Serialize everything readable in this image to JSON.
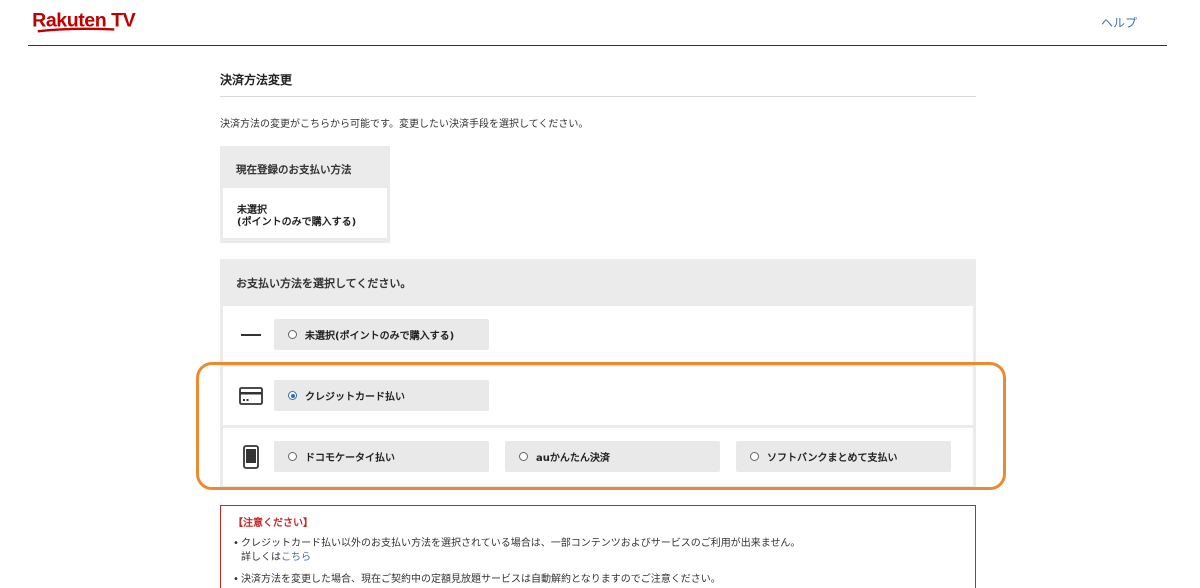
{
  "header": {
    "logo_text": "Rakuten TV",
    "help_label": "ヘルプ",
    "brand_color": "#bf0000"
  },
  "page": {
    "title": "決済方法変更",
    "intro": "決済方法の変更がこちらから可能です。変更したい決済手段を選択してください。"
  },
  "current": {
    "heading": "現在登録のお支払い方法",
    "line1": "未選択",
    "line2": "(ポイントのみで購入する)"
  },
  "select": {
    "heading": "お支払い方法を選択してください。",
    "rows": [
      {
        "icon": "dash-icon",
        "options": [
          {
            "label": "未選択(ポイントのみで購入する)",
            "checked": false
          }
        ]
      },
      {
        "icon": "credit-card-icon",
        "options": [
          {
            "label": "クレジットカード払い",
            "checked": true
          }
        ]
      },
      {
        "icon": "mobile-phone-icon",
        "options": [
          {
            "label": "ドコモケータイ払い",
            "checked": false
          },
          {
            "label": "auかんたん決済",
            "checked": false
          },
          {
            "label": "ソフトバンクまとめて支払い",
            "checked": false
          }
        ]
      }
    ]
  },
  "notice": {
    "title": "【注意ください】",
    "item1": "クレジットカード払い以外のお支払い方法を選択されている場合は、一部コンテンツおよびサービスのご利用が出来ません。",
    "item1_sub_prefix": "詳しくは",
    "item1_sub_link": "こちら",
    "item2": "決済方法を変更した場合、現在ご契約中の定額見放題サービスは自動解約となりますのでご注意ください。"
  },
  "colors": {
    "highlight": "#ec8a33",
    "link": "#3d6fae",
    "notice_red": "#c62828",
    "radio_selected": "#2f6db3"
  }
}
